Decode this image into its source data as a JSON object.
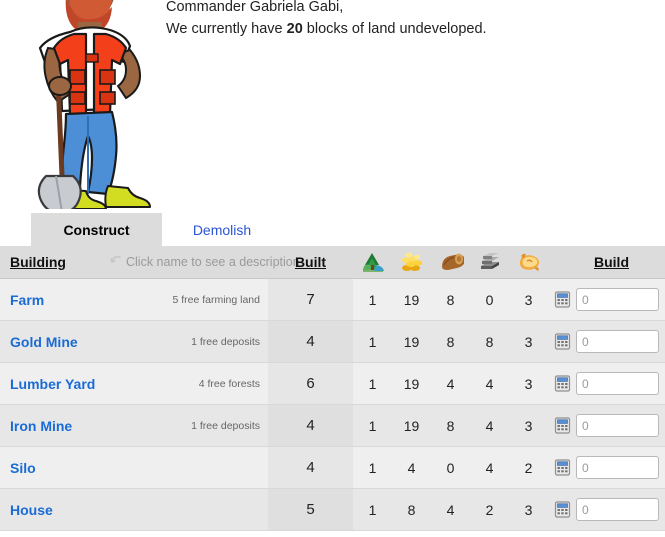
{
  "greeting": {
    "line1": "Commander Gabriela Gabi,",
    "line2_prefix": "We currently have ",
    "land_blocks": "20",
    "line2_suffix": " blocks of land undeveloped."
  },
  "tabs": [
    {
      "label": "Construct",
      "active": true
    },
    {
      "label": "Demolish",
      "active": false
    }
  ],
  "table": {
    "headers": {
      "building": "Building",
      "description_hint": "Click name to see a description",
      "built": "Built",
      "build": "Build"
    },
    "resource_icons": [
      {
        "name": "land-icon",
        "title": "Land"
      },
      {
        "name": "gold-icon",
        "title": "Gold"
      },
      {
        "name": "wood-icon",
        "title": "Wood"
      },
      {
        "name": "iron-icon",
        "title": "Iron"
      },
      {
        "name": "food-icon",
        "title": "Food"
      }
    ],
    "rows": [
      {
        "name": "Farm",
        "note": "5 free farming land",
        "built": "7",
        "land": "1",
        "gold": "19",
        "wood": "8",
        "iron": "0",
        "food": "3",
        "qty": "",
        "qty_placeholder": "0"
      },
      {
        "name": "Gold Mine",
        "note": "1 free deposits",
        "built": "4",
        "land": "1",
        "gold": "19",
        "wood": "8",
        "iron": "8",
        "food": "3",
        "qty": "",
        "qty_placeholder": "0"
      },
      {
        "name": "Lumber Yard",
        "note": "4 free forests",
        "built": "6",
        "land": "1",
        "gold": "19",
        "wood": "4",
        "iron": "4",
        "food": "3",
        "qty": "",
        "qty_placeholder": "0"
      },
      {
        "name": "Iron Mine",
        "note": "1 free deposits",
        "built": "4",
        "land": "1",
        "gold": "19",
        "wood": "8",
        "iron": "4",
        "food": "3",
        "qty": "",
        "qty_placeholder": "0"
      },
      {
        "name": "Silo",
        "note": "",
        "built": "4",
        "land": "1",
        "gold": "4",
        "wood": "0",
        "iron": "4",
        "food": "2",
        "qty": "",
        "qty_placeholder": "0"
      },
      {
        "name": "House",
        "note": "",
        "built": "5",
        "land": "1",
        "gold": "8",
        "wood": "4",
        "iron": "2",
        "food": "3",
        "qty": "",
        "qty_placeholder": "0"
      }
    ]
  },
  "colors": {
    "link_blue": "#1a6bd6",
    "tab_link_blue": "#2a55d4",
    "tab_active_bg": "#dcdcdc",
    "header_bg": "#dcdcdc",
    "row_bg": "#efefef",
    "row_alt_bg": "#e7e7e7"
  }
}
